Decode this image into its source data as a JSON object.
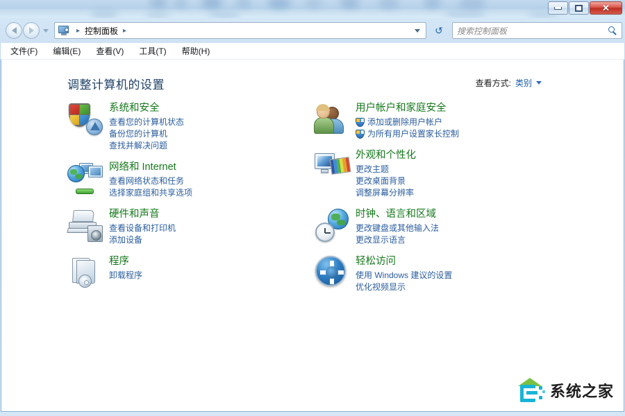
{
  "window": {
    "controls": {
      "minimize_label": "–",
      "maximize_label": "□",
      "close_label": "✕"
    }
  },
  "addressbar": {
    "back_icon": "back-arrow-icon",
    "forward_icon": "forward-arrow-icon",
    "history_icon": "chevron-down-icon",
    "breadcrumb_icon": "control-panel-icon",
    "breadcrumb": "控制面板",
    "separator": "▸",
    "refresh_icon": "refresh-icon",
    "refresh_glyph": "↺",
    "search_placeholder": "搜索控制面板",
    "search_value": ""
  },
  "menubar": {
    "items": [
      {
        "label": "文件(F)"
      },
      {
        "label": "编辑(E)"
      },
      {
        "label": "查看(V)"
      },
      {
        "label": "工具(T)"
      },
      {
        "label": "帮助(H)"
      }
    ]
  },
  "main": {
    "page_title": "调整计算机的设置",
    "viewby_label": "查看方式:",
    "viewby_value": "类别",
    "left_column": [
      {
        "title": "系统和安全",
        "icon": "shield-chart-icon",
        "links": [
          {
            "text": "查看您的计算机状态",
            "shield": false
          },
          {
            "text": "备份您的计算机",
            "shield": false
          },
          {
            "text": "查找并解决问题",
            "shield": false
          }
        ]
      },
      {
        "title": "网络和 Internet",
        "icon": "globe-monitors-icon",
        "links": [
          {
            "text": "查看网络状态和任务",
            "shield": false
          },
          {
            "text": "选择家庭组和共享选项",
            "shield": false
          }
        ]
      },
      {
        "title": "硬件和声音",
        "icon": "printer-speaker-icon",
        "links": [
          {
            "text": "查看设备和打印机",
            "shield": false
          },
          {
            "text": "添加设备",
            "shield": false
          }
        ]
      },
      {
        "title": "程序",
        "icon": "programs-icon",
        "links": [
          {
            "text": "卸载程序",
            "shield": false
          }
        ]
      }
    ],
    "right_column": [
      {
        "title": "用户帐户和家庭安全",
        "icon": "users-icon",
        "links": [
          {
            "text": "添加或删除用户帐户",
            "shield": true
          },
          {
            "text": "为所有用户设置家长控制",
            "shield": true
          }
        ]
      },
      {
        "title": "外观和个性化",
        "icon": "appearance-icon",
        "links": [
          {
            "text": "更改主题",
            "shield": false
          },
          {
            "text": "更改桌面背景",
            "shield": false
          },
          {
            "text": "调整屏幕分辨率",
            "shield": false
          }
        ]
      },
      {
        "title": "时钟、语言和区域",
        "icon": "clock-globe-icon",
        "links": [
          {
            "text": "更改键盘或其他输入法",
            "shield": false
          },
          {
            "text": "更改显示语言",
            "shield": false
          }
        ]
      },
      {
        "title": "轻松访问",
        "icon": "ease-of-access-icon",
        "links": [
          {
            "text": "使用 Windows 建议的设置",
            "shield": false
          },
          {
            "text": "优化视频显示",
            "shield": false
          }
        ]
      }
    ]
  },
  "watermark": {
    "text": "系统之家",
    "logo_icon": "xitongzhijia-logo-icon"
  },
  "colors": {
    "category_title": "#15781b",
    "link": "#2a5d9e",
    "page_title": "#1f3f66",
    "close_button": "#bb2e21",
    "watermark_logo": "#17b4d6"
  }
}
